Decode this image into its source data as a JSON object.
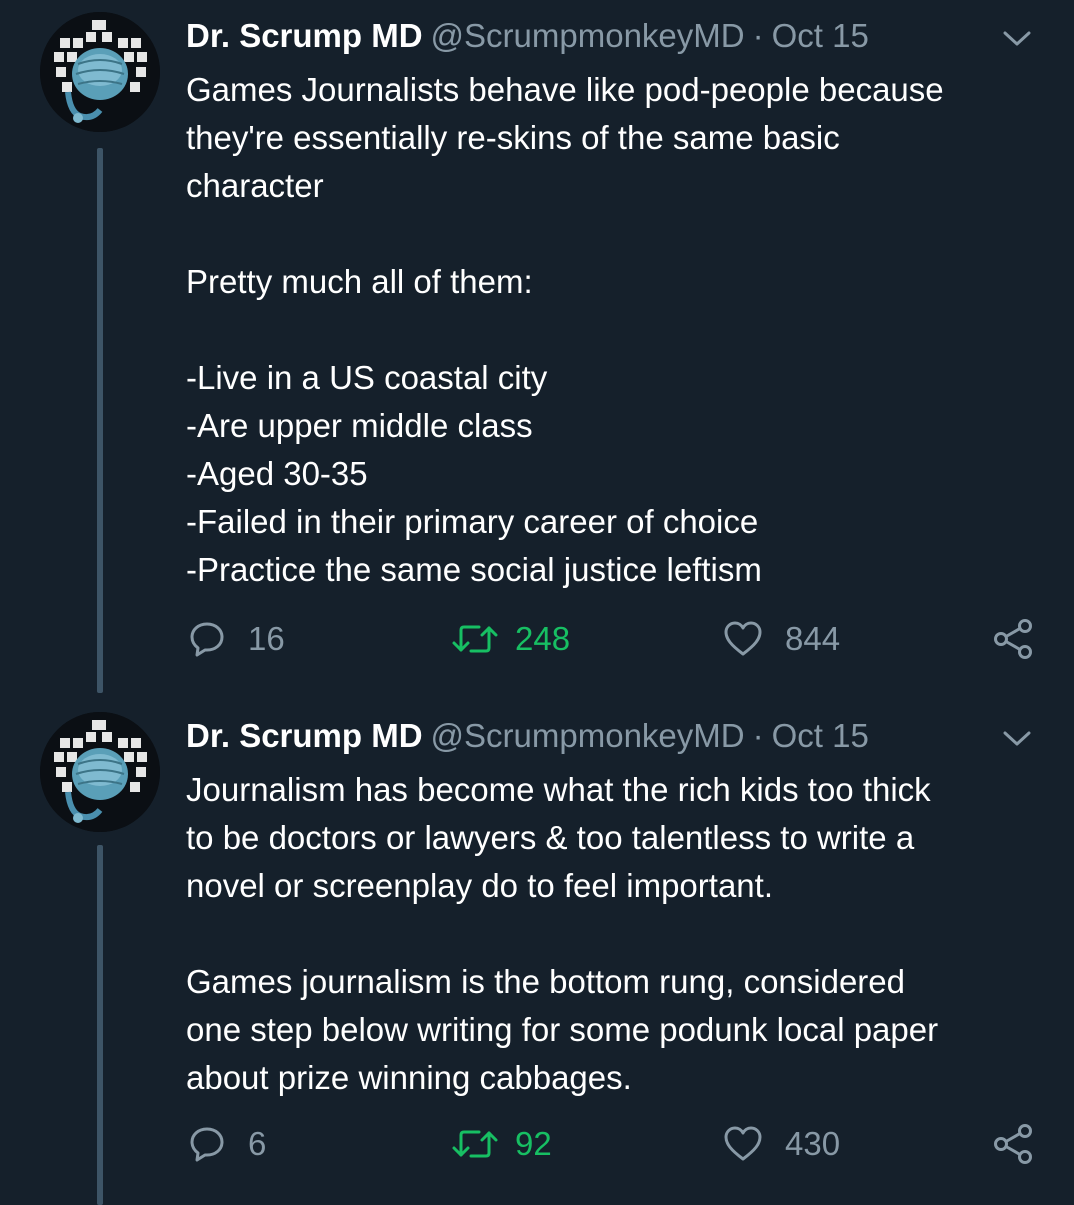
{
  "tweets": [
    {
      "author_name": "Dr. Scrump MD",
      "handle": "@ScrumpmonkeyMD",
      "separator": "·",
      "date": "Oct 15",
      "lines": [
        "Games Journalists behave like pod-people because",
        "they're essentially re-skins of the same basic",
        "character",
        "",
        "Pretty much all of them:",
        "",
        "-Live in a US coastal city",
        "-Are upper middle class",
        "-Aged 30-35",
        "-Failed in their primary career of choice",
        "-Practice the same social justice leftism"
      ],
      "reply_count": "16",
      "retweet_count": "248",
      "like_count": "844"
    },
    {
      "author_name": "Dr. Scrump MD",
      "handle": "@ScrumpmonkeyMD",
      "separator": "·",
      "date": "Oct 15",
      "lines": [
        "Journalism has become what the rich kids too thick",
        "to be doctors or lawyers & too talentless to write a",
        "novel or screenplay do to feel important.",
        "",
        "Games journalism is the bottom rung, considered",
        "one step below writing for some podunk local paper",
        "about prize winning cabbages."
      ],
      "reply_count": "6",
      "retweet_count": "92",
      "like_count": "430"
    }
  ],
  "icons": {
    "reply": "reply-icon",
    "retweet": "retweet-icon",
    "like": "heart-icon",
    "share": "share-icon",
    "menu": "chevron-down-icon",
    "avatar": "avatar-image"
  },
  "colors": {
    "background": "#15202b",
    "text_primary": "#ffffff",
    "text_secondary": "#8899a6",
    "retweet_active": "#17bf63",
    "thread_line": "#3d5466"
  }
}
